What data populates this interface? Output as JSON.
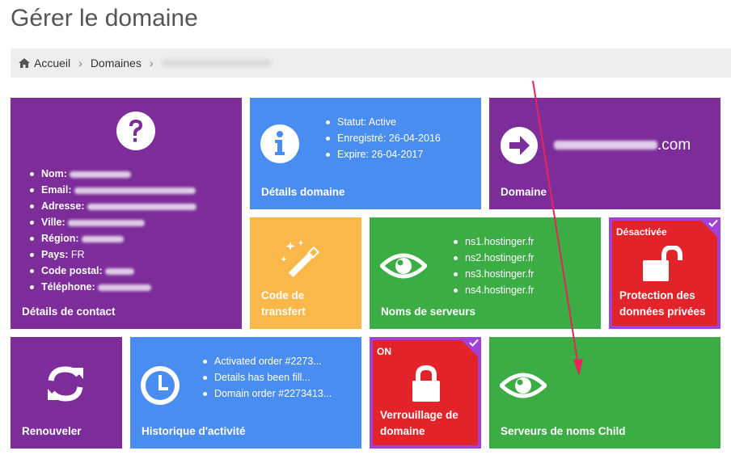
{
  "page_title": "Gérer le domaine",
  "breadcrumb": {
    "home": "Accueil",
    "domains": "Domaines"
  },
  "contact": {
    "label": "Détails de contact",
    "fields": [
      {
        "key": "Nom:",
        "value": ""
      },
      {
        "key": "Email:",
        "value": ""
      },
      {
        "key": "Adresse:",
        "value": ""
      },
      {
        "key": "Ville:",
        "value": ""
      },
      {
        "key": "Région:",
        "value": ""
      },
      {
        "key": "Pays:",
        "value": "FR"
      },
      {
        "key": "Code postal:",
        "value": ""
      },
      {
        "key": "Téléphone:",
        "value": ""
      }
    ]
  },
  "domain_details": {
    "label": "Détails domaine",
    "items": [
      "Statut: Active",
      "Enregistré: 26-04-2016",
      "Expire: 26-04-2017"
    ]
  },
  "domain": {
    "label": "Domaine",
    "name_suffix": ".com"
  },
  "transfer": {
    "label_line1": "Code de",
    "label_line2": "transfert"
  },
  "nameservers": {
    "label": "Noms de serveurs",
    "items": [
      "ns1.hostinger.fr",
      "ns2.hostinger.fr",
      "ns3.hostinger.fr",
      "ns4.hostinger.fr"
    ]
  },
  "privacy": {
    "status": "Désactivée",
    "label_line1": "Protection des",
    "label_line2": "données privées"
  },
  "renew": {
    "label": "Renouveler"
  },
  "history": {
    "label": "Historique d'activité",
    "items": [
      "Activated order #2273...",
      "Details has been fill...",
      "Domain order #2273413..."
    ]
  },
  "lock": {
    "status": "ON",
    "label_line1": "Verrouillage de",
    "label_line2": "domaine"
  },
  "child_ns": {
    "label": "Serveurs de noms Child"
  },
  "colors": {
    "purple": "#7d2d9a",
    "blue": "#4a8df0",
    "orange": "#fbb84a",
    "green": "#3cac45",
    "red": "#e3232a",
    "annotation": "#e8235a"
  }
}
